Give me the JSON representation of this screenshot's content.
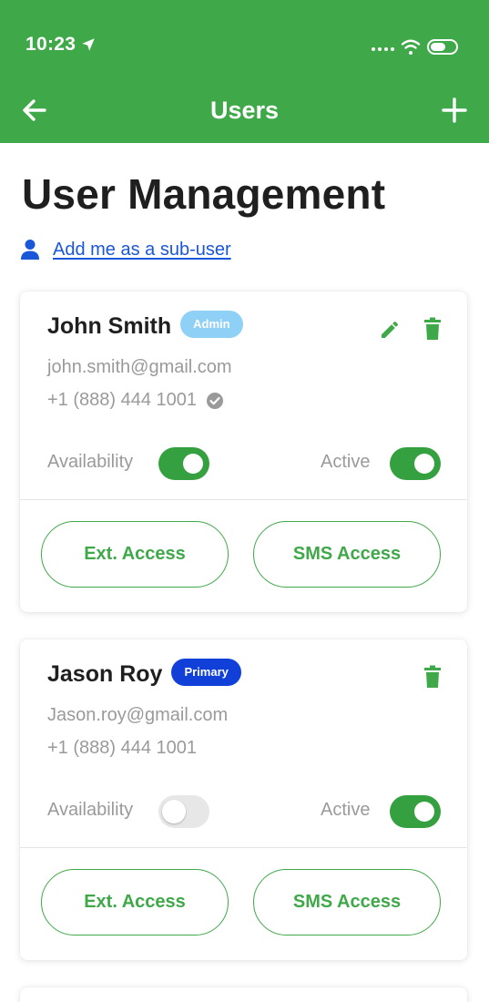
{
  "status_bar": {
    "time": "10:23"
  },
  "nav": {
    "title": "Users"
  },
  "page": {
    "title": "User Management",
    "add_sub_user_link": "Add me as a sub-user"
  },
  "users": [
    {
      "name": "John Smith",
      "badge": "Admin",
      "email": "john.smith@gmail.com",
      "phone": "+1 (888) 444 1001",
      "phone_verified": true,
      "availability_label": "Availability",
      "availability_on": true,
      "active_label": "Active",
      "active_on": true,
      "ext_access_label": "Ext. Access",
      "sms_access_label": "SMS Access"
    },
    {
      "name": "Jason Roy",
      "badge": "Primary",
      "email": "Jason.roy@gmail.com",
      "phone": "+1 (888) 444 1001",
      "phone_verified": false,
      "availability_label": "Availability",
      "availability_on": false,
      "active_label": "Active",
      "active_on": true,
      "ext_access_label": "Ext. Access",
      "sms_access_label": "SMS Access"
    }
  ],
  "colors": {
    "brand_green": "#3fa849",
    "toggle_on": "#35a03f",
    "link_blue": "#1a57d8",
    "admin_badge": "#8fd0f7",
    "primary_badge": "#1040d8"
  },
  "icons": {
    "back": "arrow-left-icon",
    "add": "plus-icon",
    "person": "person-icon",
    "edit": "pencil-icon",
    "delete": "trash-icon",
    "verified": "check-badge-icon"
  }
}
